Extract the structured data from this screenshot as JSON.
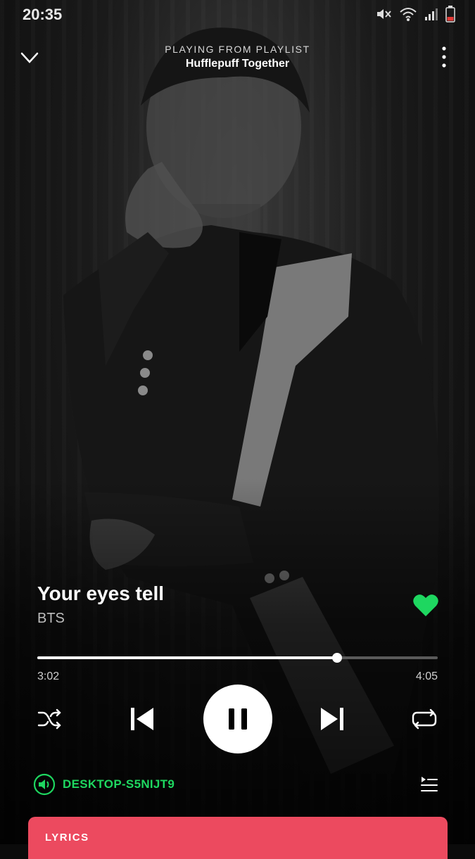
{
  "status_bar": {
    "time": "20:35"
  },
  "header": {
    "context_label": "PLAYING FROM PLAYLIST",
    "playlist_name": "Hufflepuff Together"
  },
  "track": {
    "title": "Your eyes tell",
    "artist": "BTS",
    "liked": true
  },
  "playback": {
    "elapsed": "3:02",
    "duration": "4:05",
    "progress": 0.749
  },
  "device": {
    "name": "DESKTOP-S5NIJT9"
  },
  "lyrics": {
    "label": "LYRICS"
  },
  "colors": {
    "accent": "#1ed760",
    "lyrics_card": "#ec4a5f",
    "battery": "#e53935"
  }
}
